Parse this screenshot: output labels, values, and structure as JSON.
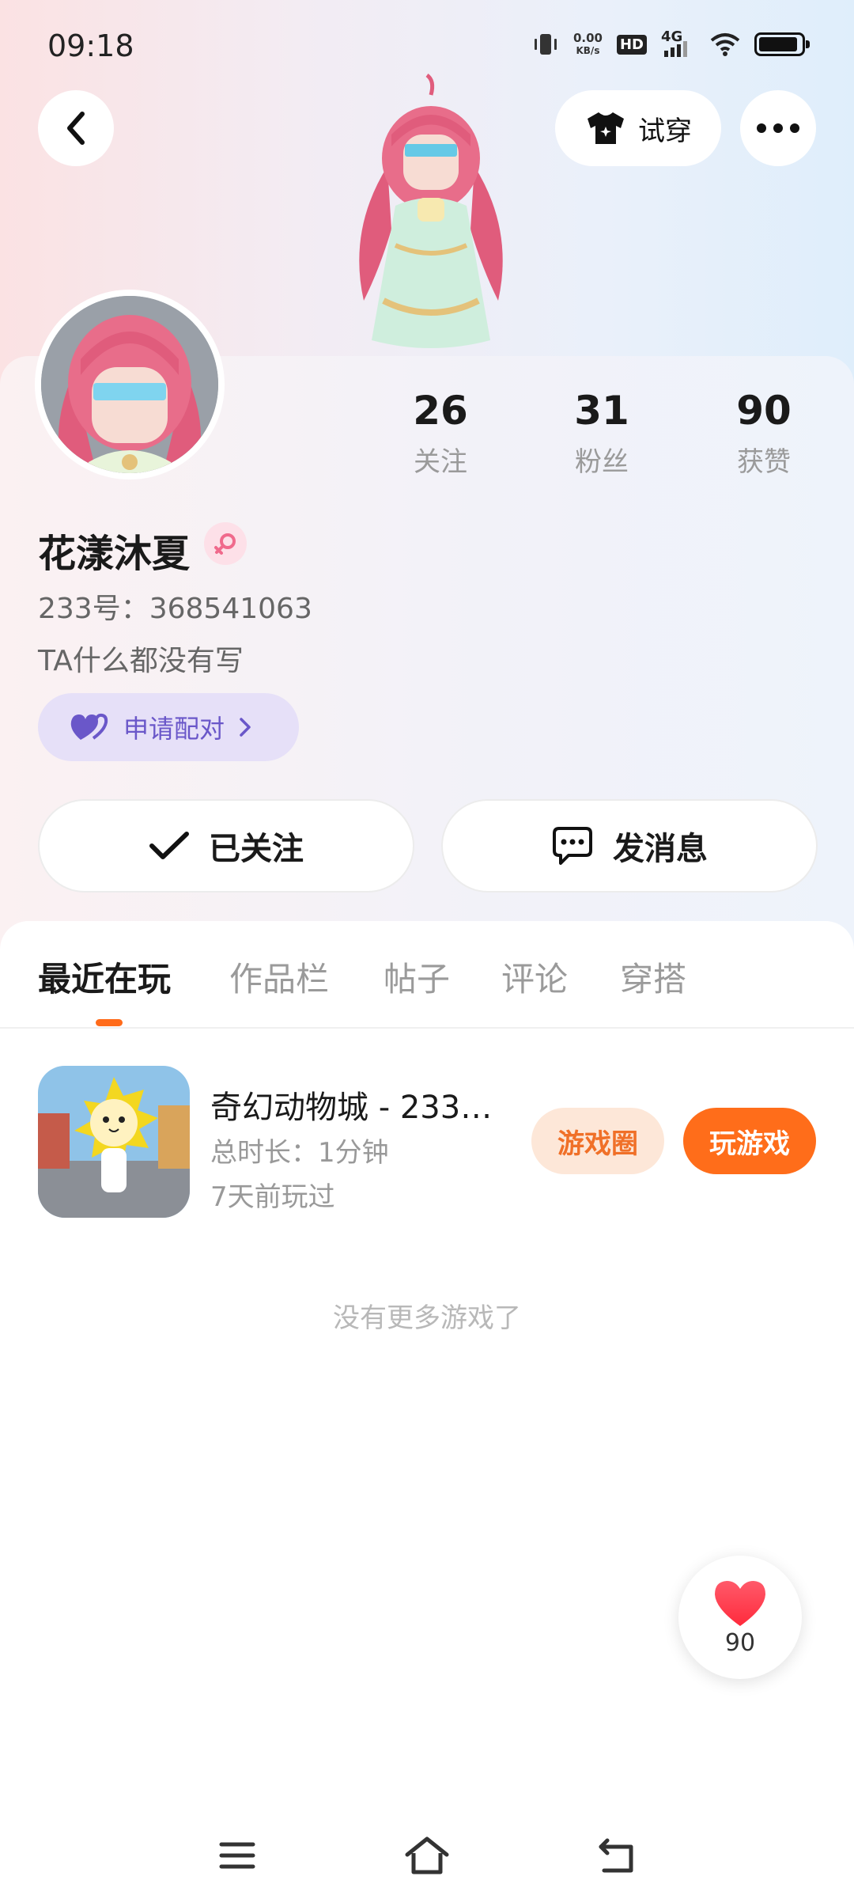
{
  "status_bar": {
    "time": "09:18",
    "speed_value": "0.00",
    "speed_unit": "KB/s",
    "hd": "HD",
    "network": "4G"
  },
  "header": {
    "tryon_label": "试穿"
  },
  "profile": {
    "stats": [
      {
        "value": "26",
        "label": "关注"
      },
      {
        "value": "31",
        "label": "粉丝"
      },
      {
        "value": "90",
        "label": "获赞"
      }
    ],
    "nickname": "花漾沐夏",
    "uid": "233号：368541063",
    "bio": "TA什么都没有写",
    "pair_label": "申请配对",
    "follow_label": "已关注",
    "message_label": "发消息"
  },
  "tabs": [
    {
      "label": "最近在玩",
      "active": true
    },
    {
      "label": "作品栏",
      "active": false
    },
    {
      "label": "帖子",
      "active": false
    },
    {
      "label": "评论",
      "active": false
    },
    {
      "label": "穿搭",
      "active": false
    }
  ],
  "games": [
    {
      "title": "奇幻动物城 - 233…",
      "duration": "总时长：1分钟",
      "last_played": "7天前玩过",
      "circle_label": "游戏圈",
      "play_label": "玩游戏"
    }
  ],
  "empty_text": "没有更多游戏了",
  "likes": {
    "count": "90"
  },
  "colors": {
    "accent_orange": "#ff6d1a",
    "pair_purple": "#6a57c9",
    "heart_red": "#ff3b4a"
  }
}
